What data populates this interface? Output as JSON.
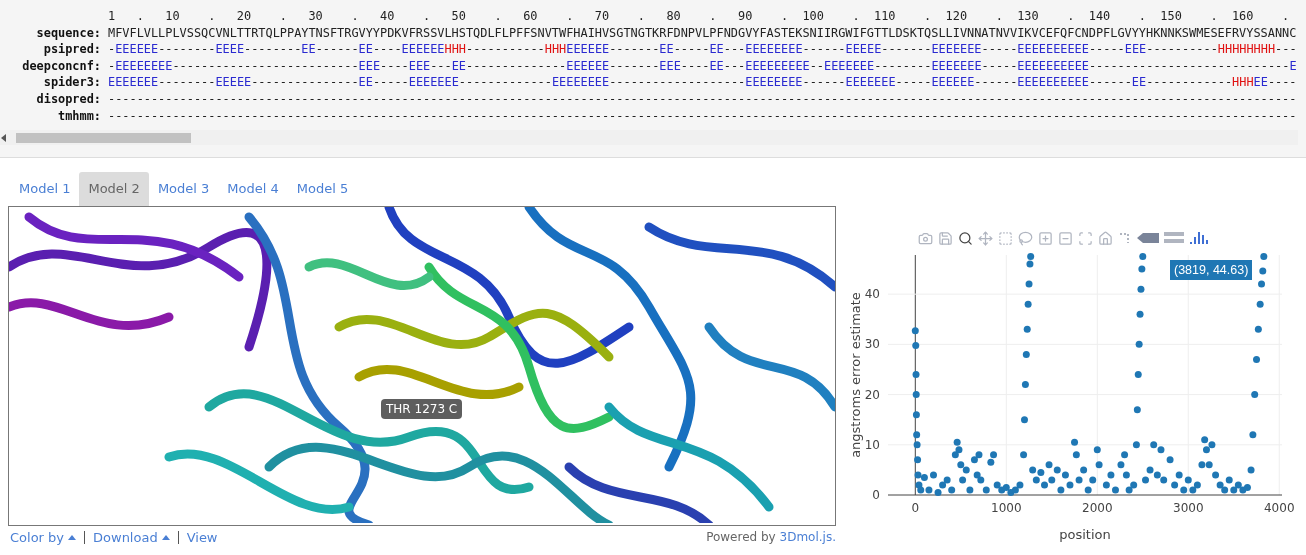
{
  "sequence_panel": {
    "ruler": "1   .   10    .   20    .   30    .   40    .   50    .   60    .   70    .   80    .   90    .  100    .  110    .  120    .  130    .  140    .  150    .  160    .",
    "rows": [
      {
        "label": "sequence:",
        "kind": "sequence",
        "text": "MFVFLVLLPLVSSQCVNLTTRTQLPPAYTNSFTRGVYYPDKVFRSSVLHSTQDLFLPFFSNVTWFHAIHVSGTNGTKRFDNPVLPFNDGVYFASTEKSNIIRGWIFGTTLDSKTQSLLIVNNATNVVIKVCEFQFCNDPFLGVYYHKNNKSWMESEFRVYSSANNC"
      },
      {
        "label": "psipred:",
        "kind": "prediction",
        "text": "-EEEEEE--------EEEE--------EE------EE----EEEEEEHHH-----------HHHEEEEEE-------EE-----EE---EEEEEEEE------EEEEE-------EEEEEEE-----EEEEEEEEEE-----EEE----------HHHHHHHH---"
      },
      {
        "label": "deepconcnf:",
        "kind": "prediction",
        "text": "-EEEEEEEE--------------------------EEE----EEE---EE--------------EEEEEE-------EEE----EE---EEEEEEEEE--EEEEEEE--------EEEEEEE-----EEEEEEEEEE----------------------------E"
      },
      {
        "label": "spider3:",
        "kind": "prediction",
        "text": "EEEEEEE--------EEEEE---------------EE-----EEEEEEE-------------EEEEEEEE-------------------EEEEEEEE------EEEEEEE-----EEEEEE------EEEEEEEEEE------EE------------HHHEE----"
      },
      {
        "label": "disopred:",
        "kind": "prediction",
        "text": "----------------------------------------------------------------------------------------------------------------------------------------------------------------------"
      },
      {
        "label": "tmhmm:",
        "kind": "prediction",
        "text": "----------------------------------------------------------------------------------------------------------------------------------------------------------------------"
      }
    ]
  },
  "tabs": [
    {
      "label": "Model 1",
      "selected": false
    },
    {
      "label": "Model 2",
      "selected": true
    },
    {
      "label": "Model 3",
      "selected": false
    },
    {
      "label": "Model 4",
      "selected": false
    },
    {
      "label": "Model 5",
      "selected": false
    }
  ],
  "viewer": {
    "hover_label": "THR 1273 C"
  },
  "viewer_footer": {
    "menus": [
      {
        "label": "Color by",
        "kind": "dropdown"
      },
      {
        "label": "Download",
        "kind": "dropdown"
      },
      {
        "label": "View",
        "kind": "link"
      }
    ],
    "credit": "Powered by",
    "credit_link": "3Dmol.js."
  },
  "plot": {
    "tooltip": "(3819, 44.63)",
    "chart_data": {
      "type": "scatter",
      "grid": true,
      "xlabel": "position",
      "ylabel": "angstroms error estimate",
      "xlim": [
        -300,
        4030
      ],
      "ylim": [
        0,
        47.8
      ],
      "xticks": [
        0,
        1000,
        2000,
        3000,
        4000
      ],
      "yticks": [
        0,
        10,
        20,
        30,
        40
      ],
      "x": [
        0,
        5,
        8,
        10,
        12,
        15,
        20,
        25,
        30,
        40,
        60,
        100,
        150,
        200,
        250,
        300,
        350,
        400,
        440,
        460,
        480,
        500,
        520,
        560,
        600,
        650,
        680,
        700,
        720,
        780,
        830,
        860,
        900,
        950,
        1000,
        1050,
        1100,
        1150,
        1190,
        1200,
        1210,
        1220,
        1230,
        1240,
        1250,
        1260,
        1268,
        1290,
        1330,
        1380,
        1420,
        1470,
        1500,
        1560,
        1600,
        1650,
        1700,
        1750,
        1770,
        1800,
        1850,
        1900,
        1950,
        2000,
        2020,
        2100,
        2150,
        2200,
        2260,
        2300,
        2320,
        2350,
        2400,
        2430,
        2440,
        2450,
        2460,
        2470,
        2480,
        2490,
        2500,
        2530,
        2580,
        2620,
        2660,
        2700,
        2730,
        2800,
        2850,
        2900,
        2950,
        3000,
        3050,
        3100,
        3150,
        3180,
        3200,
        3230,
        3260,
        3300,
        3350,
        3400,
        3450,
        3500,
        3550,
        3600,
        3650,
        3690,
        3710,
        3730,
        3750,
        3770,
        3790,
        3805,
        3819,
        3830
      ],
      "series": [
        {
          "color": "#1f77b4",
          "values": [
            32.7,
            29.8,
            24,
            20,
            16,
            12,
            10,
            7,
            4,
            2,
            1,
            3.5,
            1,
            4,
            0.5,
            2,
            3,
            1,
            8,
            10.5,
            9,
            6,
            3,
            5,
            1,
            7,
            4,
            8,
            3,
            1,
            6.5,
            8,
            2,
            1,
            1.5,
            0.5,
            1,
            2,
            8,
            15,
            22,
            28,
            33,
            38,
            42,
            46,
            47.5,
            5,
            3,
            4.5,
            2,
            6,
            3,
            5,
            1,
            4,
            2,
            10.5,
            8,
            3,
            5,
            1,
            3,
            9,
            6,
            2,
            4,
            1,
            6,
            8,
            4,
            1,
            2,
            10,
            17,
            24,
            30,
            36,
            41,
            45,
            47.5,
            3,
            5,
            10,
            4,
            9,
            3,
            7,
            2,
            4,
            1,
            3,
            1,
            2,
            6,
            11,
            9,
            6,
            10,
            4,
            2,
            1,
            3,
            1,
            2,
            1,
            1.5,
            5,
            12,
            20,
            27,
            33,
            38,
            42,
            44.6,
            47.5
          ]
        }
      ]
    }
  }
}
